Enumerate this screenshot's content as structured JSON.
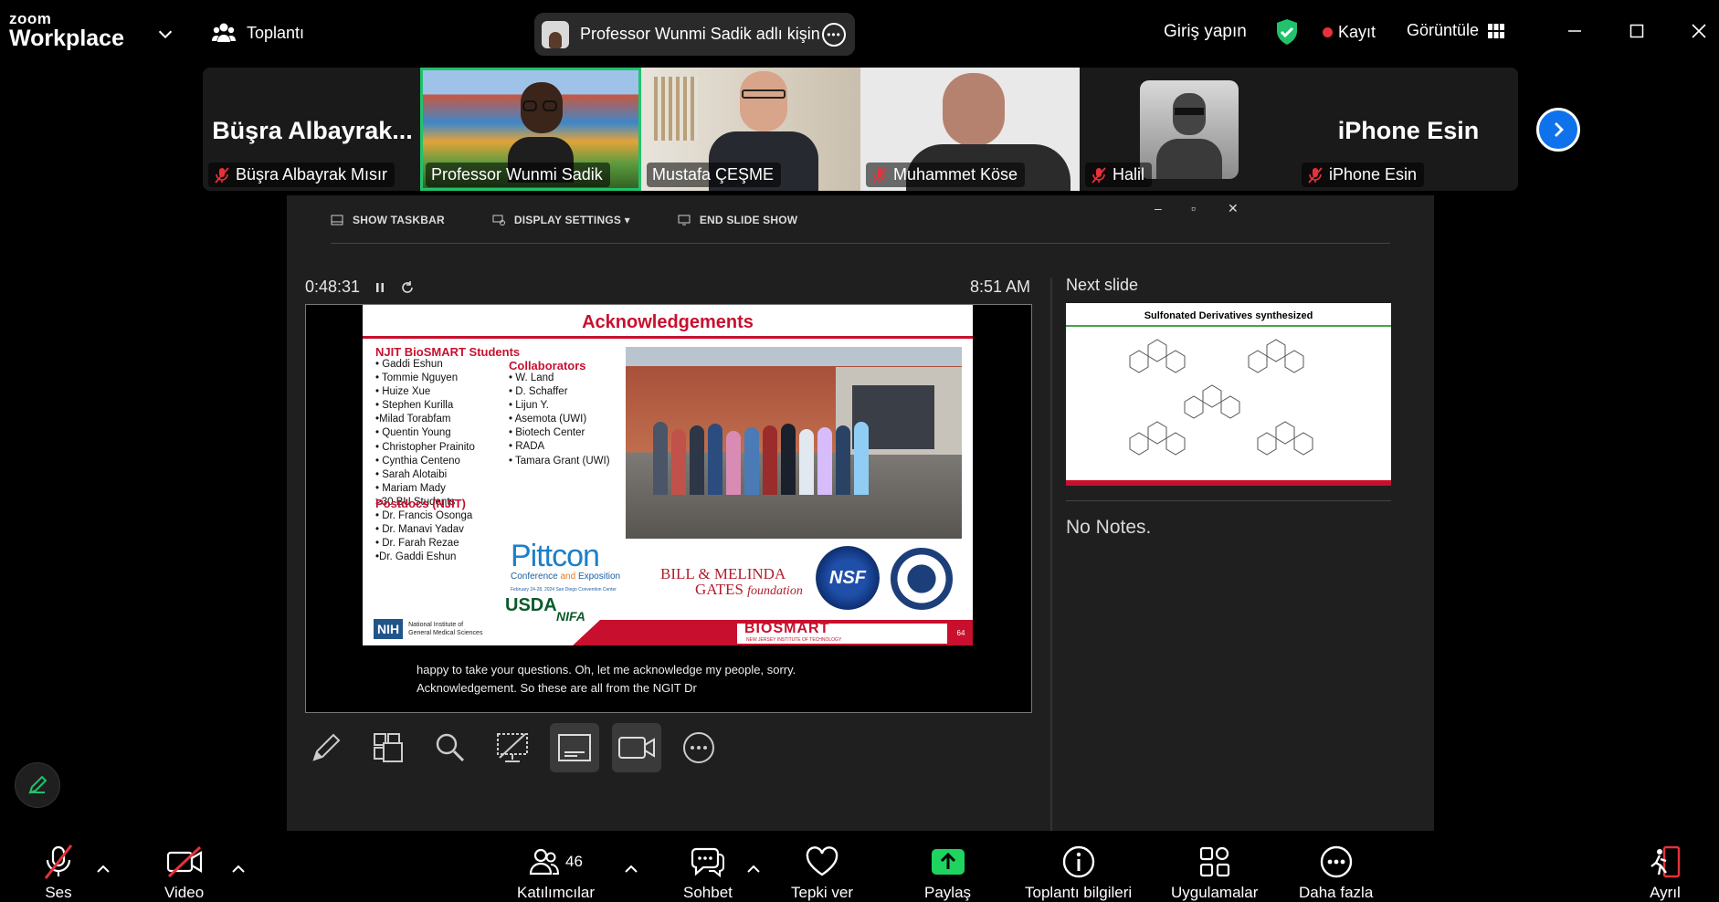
{
  "app": {
    "brand_top": "zoom",
    "brand_bottom": "Workplace",
    "meeting_label": "Toplantı"
  },
  "speaker_pill": {
    "text": "Professor Wunmi Sadik adlı kişin"
  },
  "top_right": {
    "sign_in": "Giriş yapın",
    "record": "Kayıt",
    "view": "Görüntüle"
  },
  "gallery": [
    {
      "big": "Büşra  Albayrak...",
      "label": "Büşra Albayrak Mısır",
      "muted": true
    },
    {
      "big": "",
      "label": "Professor Wunmi Sadik",
      "muted": false,
      "active": true
    },
    {
      "big": "",
      "label": "Mustafa ÇEŞME",
      "muted": false
    },
    {
      "big": "",
      "label": "Muhammet Köse",
      "muted": true
    },
    {
      "big": "",
      "label": "Halil",
      "muted": true
    },
    {
      "big": "iPhone Esin",
      "label": "iPhone Esin",
      "muted": true
    }
  ],
  "presenter": {
    "toolbar": {
      "show_taskbar": "SHOW TASKBAR",
      "display_settings": "DISPLAY SETTINGS ▾",
      "end_show": "END SLIDE SHOW"
    },
    "timer": "0:48:31",
    "clock": "8:51 AM",
    "next_slide_label": "Next slide",
    "next_slide_title": "Sulfonated Derivatives synthesized",
    "notes": "No Notes.",
    "caption_line1": "happy to take your questions. Oh, let me acknowledge my people, sorry.",
    "caption_line2": "Acknowledgement. So these are all from the NGIT Dr"
  },
  "slide": {
    "title": "Acknowledgements",
    "students_heading": "NJIT BioSMART Students",
    "students": [
      "• Gaddi Eshun",
      "• Tommie Nguyen",
      "• Huize Xue",
      "• Stephen Kurilla",
      "•Milad Torabfam",
      "• Quentin Young",
      "• Christopher Prainito",
      "• Cynthia Centeno",
      "• Sarah Alotaibi",
      "• Mariam Mady",
      ">30 BU Students"
    ],
    "collab_heading": "Collaborators",
    "collaborators": [
      "• W. Land",
      "• D. Schaffer",
      "• Lijun Y.",
      "• Asemota (UWI)",
      "• Biotech Center",
      "• RADA",
      "• Tamara Grant (UWI)"
    ],
    "postdocs_heading": "Postdocs (NJIT)",
    "postdocs": [
      "• Dr. Francis Osonga",
      "• Dr. Manavi Yadav",
      "• Dr. Farah Rezae",
      "•Dr. Gaddi Eshun"
    ],
    "pittcon": "Pittcon",
    "pittcon_sub_a": "Conference ",
    "pittcon_sub_and": "and",
    "pittcon_sub_b": " Exposition",
    "pittcon_date": "February 24-28, 2024    San Diego Convention Center",
    "gates_l1": "BILL & MELINDA",
    "gates_l2": "GATES",
    "gates_fd": "foundation",
    "nsf": "NSF",
    "nih": "NIH",
    "nih_text_1": "National Institute of",
    "nih_text_2": "General Medical Sciences",
    "usda": "USDA",
    "nifa": "NIFA",
    "biosmart": "BIOSMART",
    "biosmart_sub": "NEW JERSEY INSTITUTE OF TECHNOLOGY",
    "slide_number": "64"
  },
  "bottom": {
    "mic": "Ses",
    "video": "Video",
    "participants": "Katılımcılar",
    "participants_count": "46",
    "chat": "Sohbet",
    "react": "Tepki ver",
    "share": "Paylaş",
    "info": "Toplantı bilgileri",
    "apps": "Uygulamalar",
    "more": "Daha fazla",
    "leave": "Ayrıl"
  },
  "colors": {
    "accent": "#0e72ed",
    "share_green": "#1fd35f",
    "active_border": "#21c26b",
    "rec_red": "#e8313a",
    "mute_red": "#e8313a",
    "slide_red": "#c8102e"
  }
}
